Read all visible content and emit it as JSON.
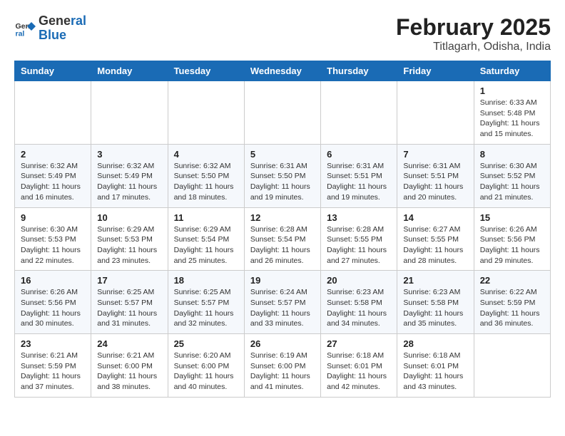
{
  "logo": {
    "text_general": "General",
    "text_blue": "Blue"
  },
  "title": "February 2025",
  "subtitle": "Titlagarh, Odisha, India",
  "days_of_week": [
    "Sunday",
    "Monday",
    "Tuesday",
    "Wednesday",
    "Thursday",
    "Friday",
    "Saturday"
  ],
  "weeks": [
    [
      {
        "day": "",
        "info": ""
      },
      {
        "day": "",
        "info": ""
      },
      {
        "day": "",
        "info": ""
      },
      {
        "day": "",
        "info": ""
      },
      {
        "day": "",
        "info": ""
      },
      {
        "day": "",
        "info": ""
      },
      {
        "day": "1",
        "info": "Sunrise: 6:33 AM\nSunset: 5:48 PM\nDaylight: 11 hours and 15 minutes."
      }
    ],
    [
      {
        "day": "2",
        "info": "Sunrise: 6:32 AM\nSunset: 5:49 PM\nDaylight: 11 hours and 16 minutes."
      },
      {
        "day": "3",
        "info": "Sunrise: 6:32 AM\nSunset: 5:49 PM\nDaylight: 11 hours and 17 minutes."
      },
      {
        "day": "4",
        "info": "Sunrise: 6:32 AM\nSunset: 5:50 PM\nDaylight: 11 hours and 18 minutes."
      },
      {
        "day": "5",
        "info": "Sunrise: 6:31 AM\nSunset: 5:50 PM\nDaylight: 11 hours and 19 minutes."
      },
      {
        "day": "6",
        "info": "Sunrise: 6:31 AM\nSunset: 5:51 PM\nDaylight: 11 hours and 19 minutes."
      },
      {
        "day": "7",
        "info": "Sunrise: 6:31 AM\nSunset: 5:51 PM\nDaylight: 11 hours and 20 minutes."
      },
      {
        "day": "8",
        "info": "Sunrise: 6:30 AM\nSunset: 5:52 PM\nDaylight: 11 hours and 21 minutes."
      }
    ],
    [
      {
        "day": "9",
        "info": "Sunrise: 6:30 AM\nSunset: 5:53 PM\nDaylight: 11 hours and 22 minutes."
      },
      {
        "day": "10",
        "info": "Sunrise: 6:29 AM\nSunset: 5:53 PM\nDaylight: 11 hours and 23 minutes."
      },
      {
        "day": "11",
        "info": "Sunrise: 6:29 AM\nSunset: 5:54 PM\nDaylight: 11 hours and 25 minutes."
      },
      {
        "day": "12",
        "info": "Sunrise: 6:28 AM\nSunset: 5:54 PM\nDaylight: 11 hours and 26 minutes."
      },
      {
        "day": "13",
        "info": "Sunrise: 6:28 AM\nSunset: 5:55 PM\nDaylight: 11 hours and 27 minutes."
      },
      {
        "day": "14",
        "info": "Sunrise: 6:27 AM\nSunset: 5:55 PM\nDaylight: 11 hours and 28 minutes."
      },
      {
        "day": "15",
        "info": "Sunrise: 6:26 AM\nSunset: 5:56 PM\nDaylight: 11 hours and 29 minutes."
      }
    ],
    [
      {
        "day": "16",
        "info": "Sunrise: 6:26 AM\nSunset: 5:56 PM\nDaylight: 11 hours and 30 minutes."
      },
      {
        "day": "17",
        "info": "Sunrise: 6:25 AM\nSunset: 5:57 PM\nDaylight: 11 hours and 31 minutes."
      },
      {
        "day": "18",
        "info": "Sunrise: 6:25 AM\nSunset: 5:57 PM\nDaylight: 11 hours and 32 minutes."
      },
      {
        "day": "19",
        "info": "Sunrise: 6:24 AM\nSunset: 5:57 PM\nDaylight: 11 hours and 33 minutes."
      },
      {
        "day": "20",
        "info": "Sunrise: 6:23 AM\nSunset: 5:58 PM\nDaylight: 11 hours and 34 minutes."
      },
      {
        "day": "21",
        "info": "Sunrise: 6:23 AM\nSunset: 5:58 PM\nDaylight: 11 hours and 35 minutes."
      },
      {
        "day": "22",
        "info": "Sunrise: 6:22 AM\nSunset: 5:59 PM\nDaylight: 11 hours and 36 minutes."
      }
    ],
    [
      {
        "day": "23",
        "info": "Sunrise: 6:21 AM\nSunset: 5:59 PM\nDaylight: 11 hours and 37 minutes."
      },
      {
        "day": "24",
        "info": "Sunrise: 6:21 AM\nSunset: 6:00 PM\nDaylight: 11 hours and 38 minutes."
      },
      {
        "day": "25",
        "info": "Sunrise: 6:20 AM\nSunset: 6:00 PM\nDaylight: 11 hours and 40 minutes."
      },
      {
        "day": "26",
        "info": "Sunrise: 6:19 AM\nSunset: 6:00 PM\nDaylight: 11 hours and 41 minutes."
      },
      {
        "day": "27",
        "info": "Sunrise: 6:18 AM\nSunset: 6:01 PM\nDaylight: 11 hours and 42 minutes."
      },
      {
        "day": "28",
        "info": "Sunrise: 6:18 AM\nSunset: 6:01 PM\nDaylight: 11 hours and 43 minutes."
      },
      {
        "day": "",
        "info": ""
      }
    ]
  ]
}
